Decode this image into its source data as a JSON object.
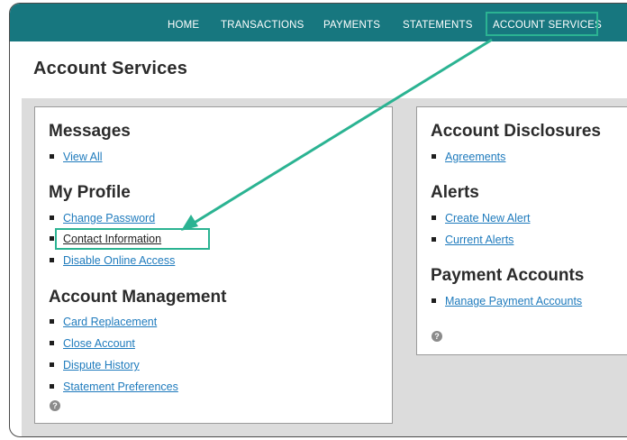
{
  "nav": {
    "items": [
      {
        "label": "HOME"
      },
      {
        "label": "TRANSACTIONS"
      },
      {
        "label": "PAYMENTS"
      },
      {
        "label": "STATEMENTS"
      },
      {
        "label": "ACCOUNT SERVICES"
      }
    ]
  },
  "page_title": "Account Services",
  "left_panel": {
    "messages": {
      "heading": "Messages",
      "links": [
        "View All"
      ]
    },
    "profile": {
      "heading": "My Profile",
      "links": [
        "Change Password",
        "Contact Information",
        "Disable Online Access"
      ]
    },
    "management": {
      "heading": "Account Management",
      "links": [
        "Card Replacement",
        "Close Account",
        "Dispute History",
        "Statement Preferences"
      ]
    },
    "help": "?"
  },
  "right_panel": {
    "disclosures": {
      "heading": "Account Disclosures",
      "links": [
        "Agreements"
      ]
    },
    "alerts": {
      "heading": "Alerts",
      "links": [
        "Create New Alert",
        "Current Alerts"
      ]
    },
    "payment": {
      "heading": "Payment Accounts",
      "links": [
        "Manage Payment Accounts"
      ]
    },
    "help": "?"
  },
  "colors": {
    "nav_bg": "#17777f",
    "highlight": "#2bb392",
    "link": "#1f7bbd"
  },
  "icons": {
    "help": "help-icon",
    "bullet": "bullet-square"
  }
}
